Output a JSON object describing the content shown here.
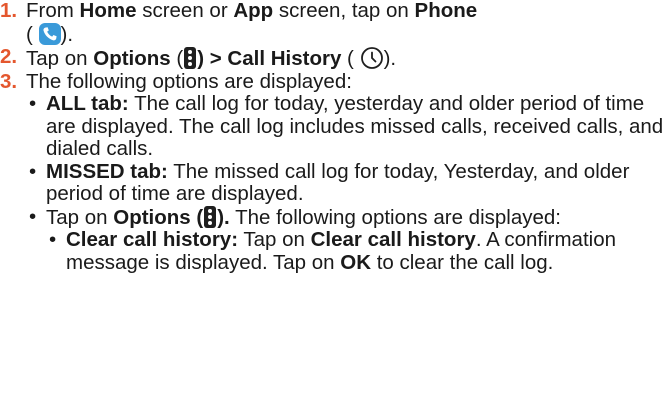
{
  "steps": [
    {
      "number": "1.",
      "part1": "From ",
      "home_screen": "Home",
      "part2": " screen or ",
      "app_screen": "App",
      "part3": " screen, tap on ",
      "phone_label": "Phone",
      "paren_open": "(",
      "paren_close": ").",
      "icon": "phone-icon"
    },
    {
      "number": "2.",
      "part1": "Tap on ",
      "options_label": "Options",
      "paren_open": " (",
      "paren_close_sep": ") > ",
      "call_history_label": "Call History",
      "paren_open2": " (",
      "paren_close2": ").",
      "icons": [
        "more-options-icon",
        "clock-icon"
      ]
    },
    {
      "number": "3.",
      "text": "The following options are displayed:"
    }
  ],
  "options": {
    "all_tab": {
      "label": "ALL tab:",
      "text": " The call log for today, yesterday and older period of time are displayed. The call log includes missed calls, received calls, and dialed calls."
    },
    "missed_tab": {
      "label": "MISSED tab:",
      "text": " The missed call log for today, Yesterday, and older period of time are displayed."
    },
    "tap_options": {
      "part1": "Tap on ",
      "options_label": "Options (",
      "options_close": ").",
      "text": " The following options are displayed:",
      "icon": "more-options-icon"
    },
    "clear_history": {
      "label": "Clear call history:",
      "part1": " Tap on ",
      "action": "Clear call history",
      "part2": ". A confirmation message is displayed. Tap on ",
      "ok_label": "OK",
      "part3": " to clear the call log."
    }
  },
  "colors": {
    "step_number": "#e4572e",
    "phone_icon_bg": "#3a9ad9",
    "text": "#1a1a1a"
  }
}
